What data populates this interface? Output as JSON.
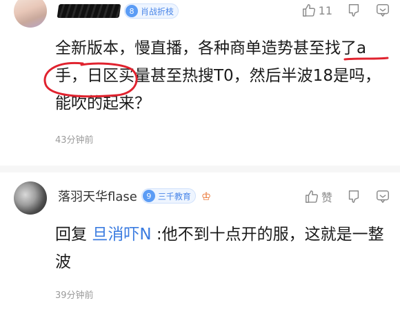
{
  "comments": [
    {
      "level_num": "8",
      "level_name": "肖战折枝",
      "like_count": "11",
      "text": "全新版本，慢直播，各种商单造势甚至找了a手，日区买量甚至热搜T0，然后半波18是吗，能吹的起来？",
      "time": "43分钟前",
      "icons": [
        "thumbs-up-icon",
        "thumbs-down-icon",
        "reply-icon"
      ]
    },
    {
      "username": "落羽天华flase",
      "level_num": "9",
      "level_name": "三千教育",
      "like_label": "赞",
      "reply_prefix": "回复",
      "mention": "旦消吓N",
      "reply_text": " :他不到十点开的服，这就是一整波",
      "time": "39分钟前",
      "icons": [
        "thumbs-up-icon",
        "thumbs-down-icon",
        "reply-icon",
        "medal-icon"
      ]
    }
  ],
  "colors": {
    "accent": "#3a7be0",
    "level_bg": "#5b9cf5",
    "annotation_red": "#e0222e"
  }
}
